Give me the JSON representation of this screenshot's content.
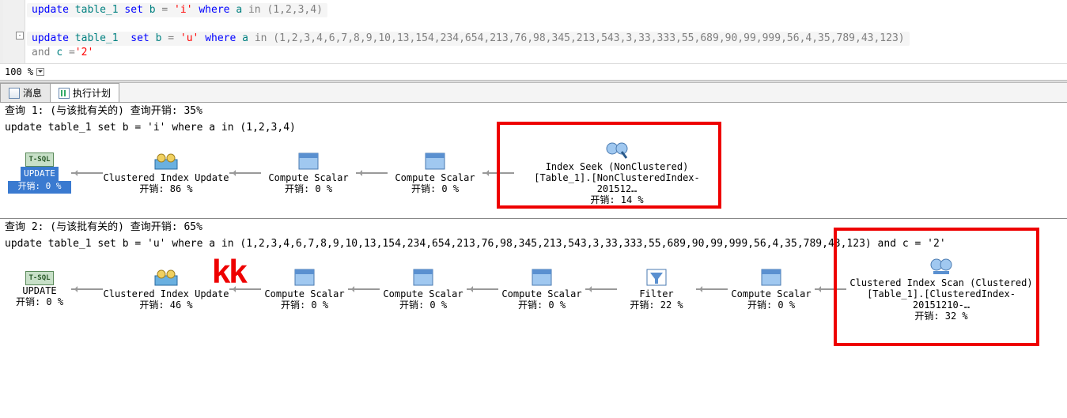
{
  "editor": {
    "line1": {
      "kw_update": "update",
      "tbl": "table_1",
      "kw_set": "set",
      "col_b": "b",
      "eq": "=",
      "val": "'i'",
      "kw_where": "where",
      "col_a": "a",
      "kw_in": "in",
      "list": "(1,2,3,4)"
    },
    "line2": {
      "kw_update": "update",
      "tbl": "table_1 ",
      "kw_set": "set",
      "col_b": "b",
      "eq": "=",
      "val": "'u'",
      "kw_where": "where",
      "col_a": "a",
      "kw_in": "in",
      "list": "(1,2,3,4,6,7,8,9,10,13,154,234,654,213,76,98,345,213,543,3,33,333,55,689,90,99,999,56,4,35,789,43,123)"
    },
    "line3": {
      "kw_and": "and",
      "col_c": "c",
      "eq": "=",
      "val": "'2'"
    }
  },
  "zoom": {
    "level": "100 %"
  },
  "tabs": {
    "messages": "消息",
    "plan": "执行计划"
  },
  "query1": {
    "header1": "查询 1: (与该批有关的) 查询开销: 35%",
    "header2": "update table_1 set b = 'i' where a in (1,2,3,4)",
    "nodes": {
      "n0": {
        "tsql": "T-SQL",
        "name": "UPDATE",
        "cost": "开销: 0 %"
      },
      "n1": {
        "name": "Clustered Index Update",
        "cost": "开销: 86 %"
      },
      "n2": {
        "name": "Compute Scalar",
        "cost": "开销: 0 %"
      },
      "n3": {
        "name": "Compute Scalar",
        "cost": "开销: 0 %"
      },
      "n4": {
        "name": "Index Seek (NonClustered)",
        "sub": "[Table_1].[NonClusteredIndex-201512…",
        "cost": "开销: 14 %"
      }
    }
  },
  "query2": {
    "header1": "查询 2: (与该批有关的) 查询开销: 65%",
    "header2": "update table_1 set b = 'u' where a in (1,2,3,4,6,7,8,9,10,13,154,234,654,213,76,98,345,213,543,3,33,333,55,689,90,99,999,56,4,35,789,43,123) and c = '2'",
    "nodes": {
      "n0": {
        "tsql": "T-SQL",
        "name": "UPDATE",
        "cost": "开销: 0 %"
      },
      "n1": {
        "name": "Clustered Index Update",
        "cost": "开销: 46 %"
      },
      "n2": {
        "name": "Compute Scalar",
        "cost": "开销: 0 %"
      },
      "n3": {
        "name": "Compute Scalar",
        "cost": "开销: 0 %"
      },
      "n4": {
        "name": "Compute Scalar",
        "cost": "开销: 0 %"
      },
      "n5": {
        "name": "Filter",
        "cost": "开销: 22 %"
      },
      "n6": {
        "name": "Compute Scalar",
        "cost": "开销: 0 %"
      },
      "n7": {
        "name": "Clustered Index Scan (Clustered)",
        "sub": "[Table_1].[ClusteredIndex-20151210-…",
        "cost": "开销: 32 %"
      }
    }
  },
  "watermark": "kk"
}
